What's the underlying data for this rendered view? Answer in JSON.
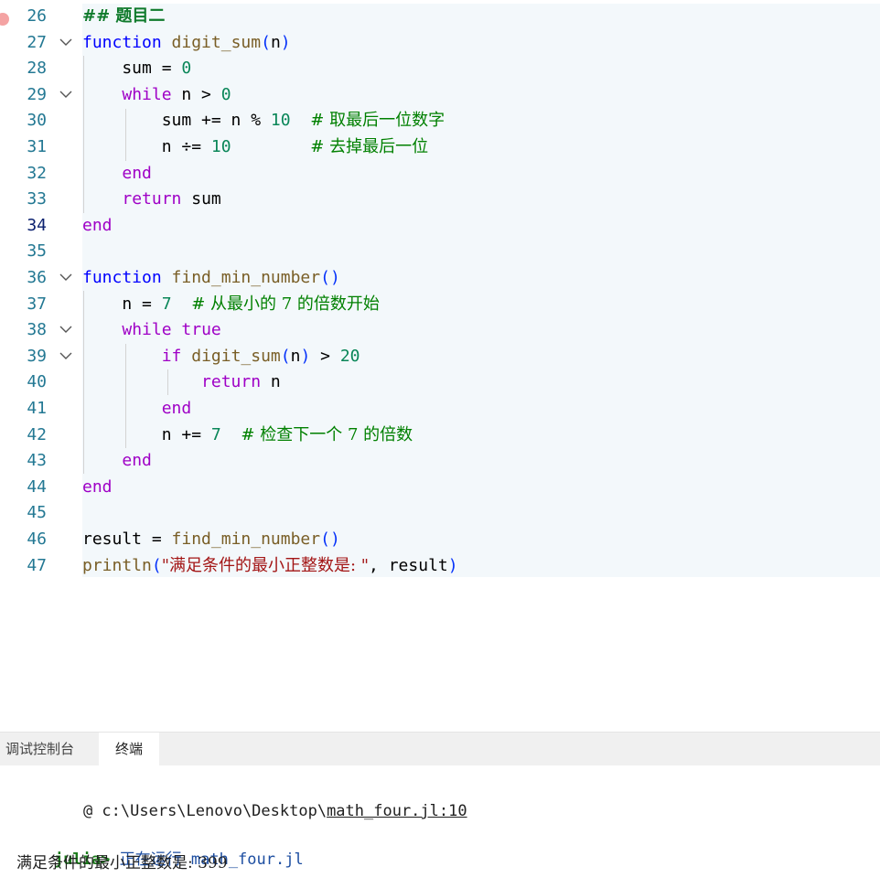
{
  "editor": {
    "lines": [
      {
        "n": "26",
        "parts": [
          {
            "t": "## 题目二",
            "c": "mdh cjk"
          }
        ],
        "bp": true
      },
      {
        "n": "27",
        "fold": true,
        "parts": [
          {
            "t": "function",
            "c": "kwb"
          },
          {
            "t": " "
          },
          {
            "t": "digit_sum",
            "c": "fn"
          },
          {
            "t": "(",
            "c": "par1"
          },
          {
            "t": "n"
          },
          {
            "t": ")",
            "c": "par1"
          }
        ]
      },
      {
        "n": "28",
        "parts": [
          {
            "t": "    sum = "
          },
          {
            "t": "0",
            "c": "num"
          }
        ]
      },
      {
        "n": "29",
        "fold": true,
        "parts": [
          {
            "t": "    "
          },
          {
            "t": "while",
            "c": "kw"
          },
          {
            "t": " n > "
          },
          {
            "t": "0",
            "c": "num"
          }
        ]
      },
      {
        "n": "30",
        "parts": [
          {
            "t": "        sum += n % "
          },
          {
            "t": "10",
            "c": "num"
          },
          {
            "t": "  "
          },
          {
            "t": "# 取最后一位数字",
            "c": "cm"
          }
        ]
      },
      {
        "n": "31",
        "parts": [
          {
            "t": "        n ÷= "
          },
          {
            "t": "10",
            "c": "num"
          },
          {
            "t": "        "
          },
          {
            "t": "# 去掉最后一位",
            "c": "cm"
          }
        ]
      },
      {
        "n": "32",
        "parts": [
          {
            "t": "    "
          },
          {
            "t": "end",
            "c": "kw"
          }
        ]
      },
      {
        "n": "33",
        "parts": [
          {
            "t": "    "
          },
          {
            "t": "return",
            "c": "kw"
          },
          {
            "t": " sum"
          }
        ]
      },
      {
        "n": "34",
        "active": true,
        "parts": [
          {
            "t": "end",
            "c": "kw"
          }
        ]
      },
      {
        "n": "35",
        "parts": []
      },
      {
        "n": "36",
        "fold": true,
        "parts": [
          {
            "t": "function",
            "c": "kwb"
          },
          {
            "t": " "
          },
          {
            "t": "find_min_number",
            "c": "fn"
          },
          {
            "t": "()",
            "c": "par1"
          }
        ]
      },
      {
        "n": "37",
        "parts": [
          {
            "t": "    n = "
          },
          {
            "t": "7",
            "c": "num"
          },
          {
            "t": "  "
          },
          {
            "t": "# 从最小的 7 的倍数开始",
            "c": "cm"
          }
        ]
      },
      {
        "n": "38",
        "fold": true,
        "parts": [
          {
            "t": "    "
          },
          {
            "t": "while",
            "c": "kw"
          },
          {
            "t": " "
          },
          {
            "t": "true",
            "c": "kw"
          }
        ]
      },
      {
        "n": "39",
        "fold": true,
        "parts": [
          {
            "t": "        "
          },
          {
            "t": "if",
            "c": "kw"
          },
          {
            "t": " "
          },
          {
            "t": "digit_sum",
            "c": "fn"
          },
          {
            "t": "(",
            "c": "par1"
          },
          {
            "t": "n"
          },
          {
            "t": ")",
            "c": "par1"
          },
          {
            "t": " > "
          },
          {
            "t": "20",
            "c": "num"
          }
        ]
      },
      {
        "n": "40",
        "parts": [
          {
            "t": "            "
          },
          {
            "t": "return",
            "c": "kw"
          },
          {
            "t": " n"
          }
        ]
      },
      {
        "n": "41",
        "parts": [
          {
            "t": "        "
          },
          {
            "t": "end",
            "c": "kw"
          }
        ]
      },
      {
        "n": "42",
        "parts": [
          {
            "t": "        n += "
          },
          {
            "t": "7",
            "c": "num"
          },
          {
            "t": "  "
          },
          {
            "t": "# 检查下一个 7 的倍数",
            "c": "cm"
          }
        ]
      },
      {
        "n": "43",
        "parts": [
          {
            "t": "    "
          },
          {
            "t": "end",
            "c": "kw"
          }
        ]
      },
      {
        "n": "44",
        "parts": [
          {
            "t": "end",
            "c": "kw"
          }
        ]
      },
      {
        "n": "45",
        "parts": []
      },
      {
        "n": "46",
        "parts": [
          {
            "t": "result = "
          },
          {
            "t": "find_min_number",
            "c": "fn"
          },
          {
            "t": "()",
            "c": "par1"
          }
        ]
      },
      {
        "n": "47",
        "parts": [
          {
            "t": "println",
            "c": "fn"
          },
          {
            "t": "(",
            "c": "par1"
          },
          {
            "t": "\"满足条件的最小正整数是: \"",
            "c": "str"
          },
          {
            "t": ", result"
          },
          {
            "t": ")",
            "c": "par1"
          }
        ]
      }
    ]
  },
  "panel": {
    "tabs": [
      {
        "label": "调试控制台",
        "active": false
      },
      {
        "label": "终端",
        "active": true
      }
    ],
    "terminal": {
      "location_prefix": "@ c:\\Users\\Lenovo\\Desktop\\",
      "location_link": "math_four.jl:10",
      "prompt": "julia>",
      "running_text": "正在运行",
      "running_file": "math_four.jl",
      "output": "满足条件的最小正整数是: 399"
    }
  },
  "colors": {
    "cell_background": "#f3f8fb",
    "keyword": "#9f00c6",
    "number": "#098658",
    "comment": "#008000",
    "line_number": "#237893"
  }
}
